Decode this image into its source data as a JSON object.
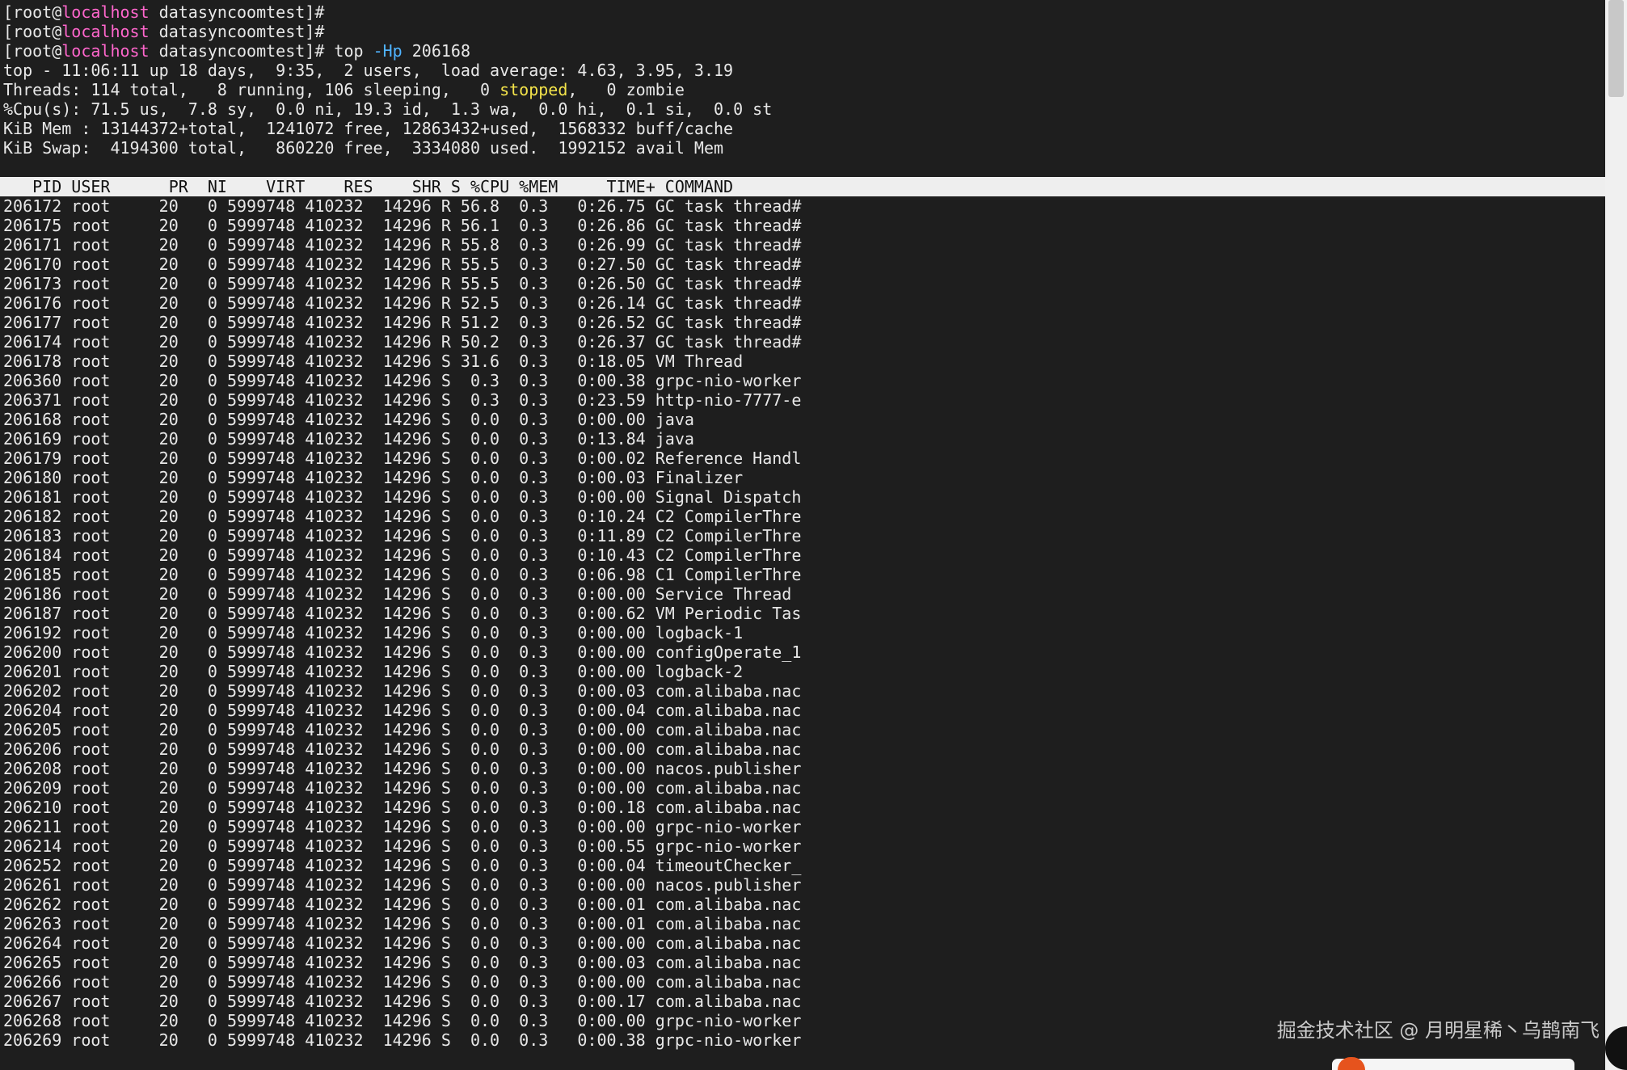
{
  "prompt_lines": [
    {
      "prefix": "[root@",
      "host": "localhost",
      "suffix": " datasyncoomtest]#",
      "command": "",
      "flag": "",
      "arg": ""
    },
    {
      "prefix": "[root@",
      "host": "localhost",
      "suffix": " datasyncoomtest]#",
      "command": "",
      "flag": "",
      "arg": ""
    },
    {
      "prefix": "[root@",
      "host": "localhost",
      "suffix": " datasyncoomtest]#",
      "command": " top ",
      "flag": "-Hp",
      "arg": " 206168"
    }
  ],
  "summary": {
    "uptime_line": "top - 11:06:11 up 18 days,  9:35,  2 users,  load average: 4.63, 3.95, 3.19",
    "threads_before": "Threads: 114 total,   8 running, 106 sleeping,   0 ",
    "threads_stopped": "stopped",
    "threads_after": ",   0 zombie",
    "cpu_line": "%Cpu(s): 71.5 us,  7.8 sy,  0.0 ni, 19.3 id,  1.3 wa,  0.0 hi,  0.1 si,  0.0 st",
    "mem_line": "KiB Mem : 13144372+total,  1241072 free, 12863432+used,  1568332 buff/cache",
    "swap_line": "KiB Swap:  4194300 total,   860220 free,  3334080 used.  1992152 avail Mem"
  },
  "table": {
    "header": "   PID USER      PR  NI    VIRT    RES    SHR S %CPU %MEM     TIME+ COMMAND",
    "columns": [
      "PID",
      "USER",
      "PR",
      "NI",
      "VIRT",
      "RES",
      "SHR",
      "S",
      "%CPU",
      "%MEM",
      "TIME+",
      "COMMAND"
    ],
    "rows": [
      [
        "206172",
        "root",
        "20",
        "0",
        "5999748",
        "410232",
        "14296",
        "R",
        "56.8",
        "0.3",
        "0:26.75",
        "GC task thread#"
      ],
      [
        "206175",
        "root",
        "20",
        "0",
        "5999748",
        "410232",
        "14296",
        "R",
        "56.1",
        "0.3",
        "0:26.86",
        "GC task thread#"
      ],
      [
        "206171",
        "root",
        "20",
        "0",
        "5999748",
        "410232",
        "14296",
        "R",
        "55.8",
        "0.3",
        "0:26.99",
        "GC task thread#"
      ],
      [
        "206170",
        "root",
        "20",
        "0",
        "5999748",
        "410232",
        "14296",
        "R",
        "55.5",
        "0.3",
        "0:27.50",
        "GC task thread#"
      ],
      [
        "206173",
        "root",
        "20",
        "0",
        "5999748",
        "410232",
        "14296",
        "R",
        "55.5",
        "0.3",
        "0:26.50",
        "GC task thread#"
      ],
      [
        "206176",
        "root",
        "20",
        "0",
        "5999748",
        "410232",
        "14296",
        "R",
        "52.5",
        "0.3",
        "0:26.14",
        "GC task thread#"
      ],
      [
        "206177",
        "root",
        "20",
        "0",
        "5999748",
        "410232",
        "14296",
        "R",
        "51.2",
        "0.3",
        "0:26.52",
        "GC task thread#"
      ],
      [
        "206174",
        "root",
        "20",
        "0",
        "5999748",
        "410232",
        "14296",
        "R",
        "50.2",
        "0.3",
        "0:26.37",
        "GC task thread#"
      ],
      [
        "206178",
        "root",
        "20",
        "0",
        "5999748",
        "410232",
        "14296",
        "S",
        "31.6",
        "0.3",
        "0:18.05",
        "VM Thread"
      ],
      [
        "206360",
        "root",
        "20",
        "0",
        "5999748",
        "410232",
        "14296",
        "S",
        "0.3",
        "0.3",
        "0:00.38",
        "grpc-nio-worker"
      ],
      [
        "206371",
        "root",
        "20",
        "0",
        "5999748",
        "410232",
        "14296",
        "S",
        "0.3",
        "0.3",
        "0:23.59",
        "http-nio-7777-e"
      ],
      [
        "206168",
        "root",
        "20",
        "0",
        "5999748",
        "410232",
        "14296",
        "S",
        "0.0",
        "0.3",
        "0:00.00",
        "java"
      ],
      [
        "206169",
        "root",
        "20",
        "0",
        "5999748",
        "410232",
        "14296",
        "S",
        "0.0",
        "0.3",
        "0:13.84",
        "java"
      ],
      [
        "206179",
        "root",
        "20",
        "0",
        "5999748",
        "410232",
        "14296",
        "S",
        "0.0",
        "0.3",
        "0:00.02",
        "Reference Handl"
      ],
      [
        "206180",
        "root",
        "20",
        "0",
        "5999748",
        "410232",
        "14296",
        "S",
        "0.0",
        "0.3",
        "0:00.03",
        "Finalizer"
      ],
      [
        "206181",
        "root",
        "20",
        "0",
        "5999748",
        "410232",
        "14296",
        "S",
        "0.0",
        "0.3",
        "0:00.00",
        "Signal Dispatch"
      ],
      [
        "206182",
        "root",
        "20",
        "0",
        "5999748",
        "410232",
        "14296",
        "S",
        "0.0",
        "0.3",
        "0:10.24",
        "C2 CompilerThre"
      ],
      [
        "206183",
        "root",
        "20",
        "0",
        "5999748",
        "410232",
        "14296",
        "S",
        "0.0",
        "0.3",
        "0:11.89",
        "C2 CompilerThre"
      ],
      [
        "206184",
        "root",
        "20",
        "0",
        "5999748",
        "410232",
        "14296",
        "S",
        "0.0",
        "0.3",
        "0:10.43",
        "C2 CompilerThre"
      ],
      [
        "206185",
        "root",
        "20",
        "0",
        "5999748",
        "410232",
        "14296",
        "S",
        "0.0",
        "0.3",
        "0:06.98",
        "C1 CompilerThre"
      ],
      [
        "206186",
        "root",
        "20",
        "0",
        "5999748",
        "410232",
        "14296",
        "S",
        "0.0",
        "0.3",
        "0:00.00",
        "Service Thread"
      ],
      [
        "206187",
        "root",
        "20",
        "0",
        "5999748",
        "410232",
        "14296",
        "S",
        "0.0",
        "0.3",
        "0:00.62",
        "VM Periodic Tas"
      ],
      [
        "206192",
        "root",
        "20",
        "0",
        "5999748",
        "410232",
        "14296",
        "S",
        "0.0",
        "0.3",
        "0:00.00",
        "logback-1"
      ],
      [
        "206200",
        "root",
        "20",
        "0",
        "5999748",
        "410232",
        "14296",
        "S",
        "0.0",
        "0.3",
        "0:00.00",
        "configOperate_1"
      ],
      [
        "206201",
        "root",
        "20",
        "0",
        "5999748",
        "410232",
        "14296",
        "S",
        "0.0",
        "0.3",
        "0:00.00",
        "logback-2"
      ],
      [
        "206202",
        "root",
        "20",
        "0",
        "5999748",
        "410232",
        "14296",
        "S",
        "0.0",
        "0.3",
        "0:00.03",
        "com.alibaba.nac"
      ],
      [
        "206204",
        "root",
        "20",
        "0",
        "5999748",
        "410232",
        "14296",
        "S",
        "0.0",
        "0.3",
        "0:00.04",
        "com.alibaba.nac"
      ],
      [
        "206205",
        "root",
        "20",
        "0",
        "5999748",
        "410232",
        "14296",
        "S",
        "0.0",
        "0.3",
        "0:00.00",
        "com.alibaba.nac"
      ],
      [
        "206206",
        "root",
        "20",
        "0",
        "5999748",
        "410232",
        "14296",
        "S",
        "0.0",
        "0.3",
        "0:00.00",
        "com.alibaba.nac"
      ],
      [
        "206208",
        "root",
        "20",
        "0",
        "5999748",
        "410232",
        "14296",
        "S",
        "0.0",
        "0.3",
        "0:00.00",
        "nacos.publisher"
      ],
      [
        "206209",
        "root",
        "20",
        "0",
        "5999748",
        "410232",
        "14296",
        "S",
        "0.0",
        "0.3",
        "0:00.00",
        "com.alibaba.nac"
      ],
      [
        "206210",
        "root",
        "20",
        "0",
        "5999748",
        "410232",
        "14296",
        "S",
        "0.0",
        "0.3",
        "0:00.18",
        "com.alibaba.nac"
      ],
      [
        "206211",
        "root",
        "20",
        "0",
        "5999748",
        "410232",
        "14296",
        "S",
        "0.0",
        "0.3",
        "0:00.00",
        "grpc-nio-worker"
      ],
      [
        "206214",
        "root",
        "20",
        "0",
        "5999748",
        "410232",
        "14296",
        "S",
        "0.0",
        "0.3",
        "0:00.55",
        "grpc-nio-worker"
      ],
      [
        "206252",
        "root",
        "20",
        "0",
        "5999748",
        "410232",
        "14296",
        "S",
        "0.0",
        "0.3",
        "0:00.04",
        "timeoutChecker_"
      ],
      [
        "206261",
        "root",
        "20",
        "0",
        "5999748",
        "410232",
        "14296",
        "S",
        "0.0",
        "0.3",
        "0:00.00",
        "nacos.publisher"
      ],
      [
        "206262",
        "root",
        "20",
        "0",
        "5999748",
        "410232",
        "14296",
        "S",
        "0.0",
        "0.3",
        "0:00.01",
        "com.alibaba.nac"
      ],
      [
        "206263",
        "root",
        "20",
        "0",
        "5999748",
        "410232",
        "14296",
        "S",
        "0.0",
        "0.3",
        "0:00.01",
        "com.alibaba.nac"
      ],
      [
        "206264",
        "root",
        "20",
        "0",
        "5999748",
        "410232",
        "14296",
        "S",
        "0.0",
        "0.3",
        "0:00.00",
        "com.alibaba.nac"
      ],
      [
        "206265",
        "root",
        "20",
        "0",
        "5999748",
        "410232",
        "14296",
        "S",
        "0.0",
        "0.3",
        "0:00.03",
        "com.alibaba.nac"
      ],
      [
        "206266",
        "root",
        "20",
        "0",
        "5999748",
        "410232",
        "14296",
        "S",
        "0.0",
        "0.3",
        "0:00.00",
        "com.alibaba.nac"
      ],
      [
        "206267",
        "root",
        "20",
        "0",
        "5999748",
        "410232",
        "14296",
        "S",
        "0.0",
        "0.3",
        "0:00.17",
        "com.alibaba.nac"
      ],
      [
        "206268",
        "root",
        "20",
        "0",
        "5999748",
        "410232",
        "14296",
        "S",
        "0.0",
        "0.3",
        "0:00.00",
        "grpc-nio-worker"
      ],
      [
        "206269",
        "root",
        "20",
        "0",
        "5999748",
        "410232",
        "14296",
        "S",
        "0.0",
        "0.3",
        "0:00.38",
        "grpc-nio-worker"
      ]
    ]
  },
  "watermark": {
    "text": "掘金技术社区 @ 月明星稀丶乌鹊南飞"
  },
  "colors": {
    "background": "#1e1e1e",
    "foreground": "#e8e8e8",
    "hostname": "#ff66cc",
    "flag": "#4fb3ff",
    "stopped": "#f3e34a",
    "header_bg": "#eeeeee",
    "header_fg": "#111111"
  }
}
